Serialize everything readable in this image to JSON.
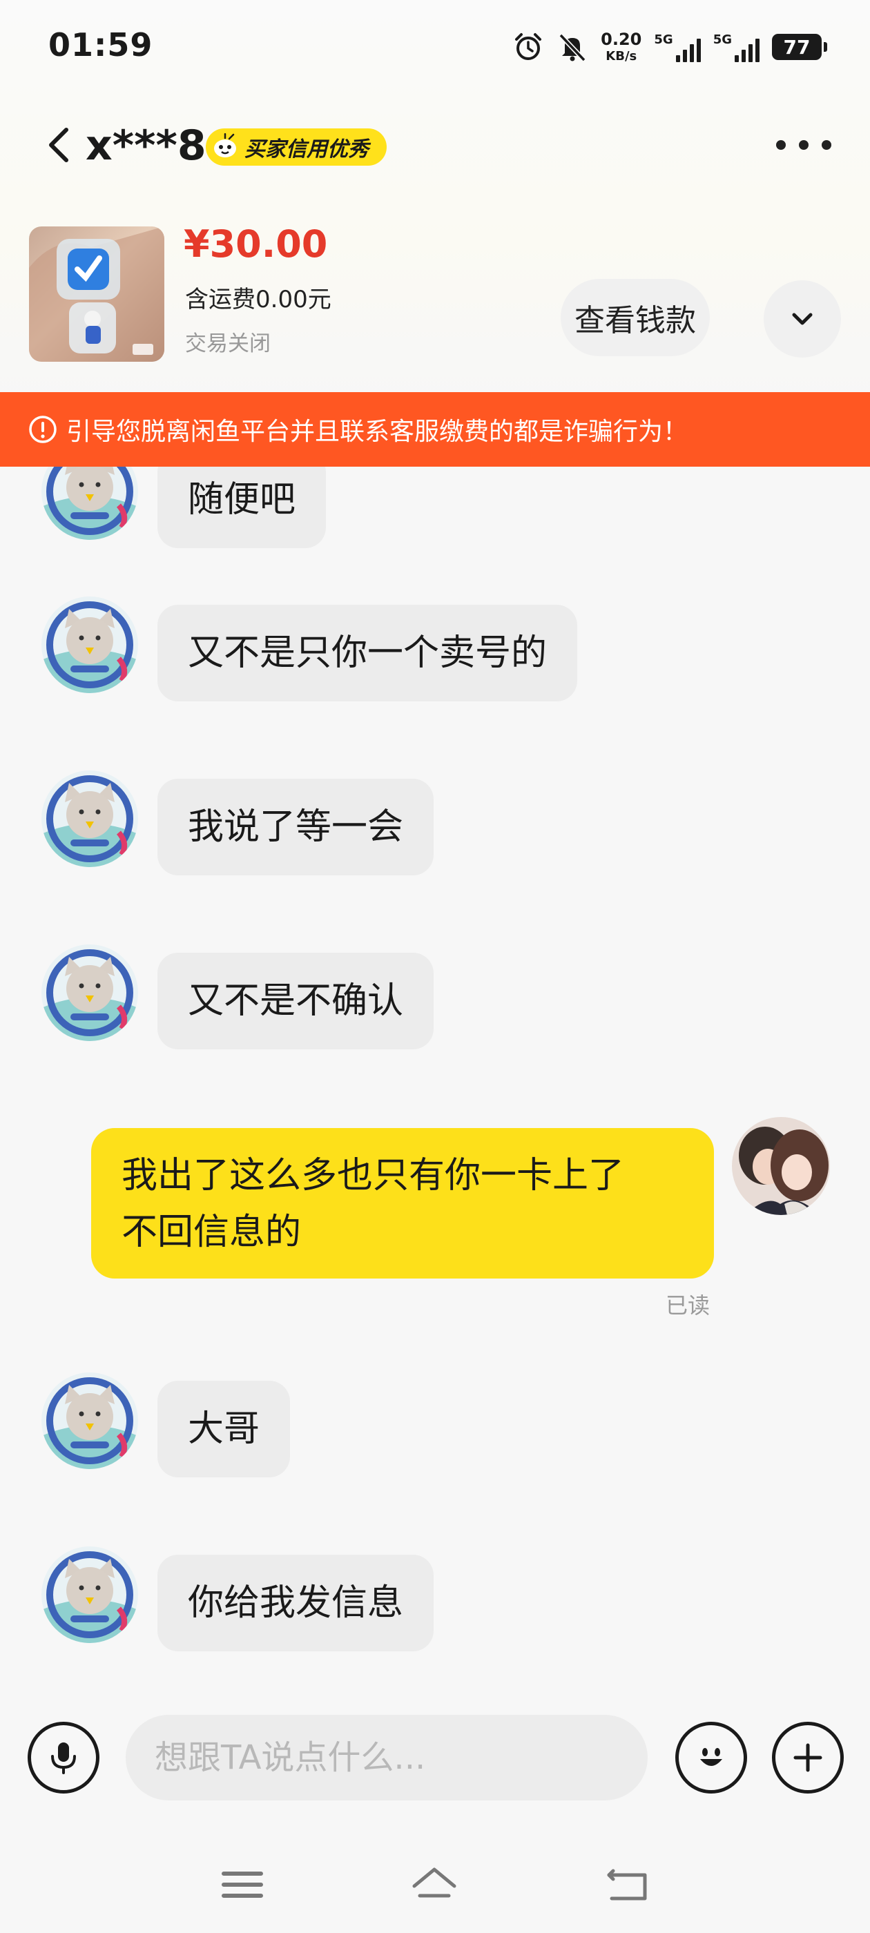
{
  "status_bar": {
    "time": "01:59",
    "net_speed_value": "0.20",
    "net_speed_unit": "KB/s",
    "sim1_label": "5G",
    "sim2_label": "5G",
    "battery": "77"
  },
  "header": {
    "nickname": "x***8",
    "badge": "买家信用优秀",
    "badge_color": "#ffe11b"
  },
  "product": {
    "price": "¥30.00",
    "postage": "含运费0.00元",
    "trade_status": "交易关闭",
    "view_button": "查看钱款",
    "price_color": "#e53a2a"
  },
  "warning": {
    "text": "引导您脱离闲鱼平台并且联系客服缴费的都是诈骗行为！",
    "color": "#ff5722"
  },
  "messages": [
    {
      "sender": "other",
      "text": "随便吧"
    },
    {
      "sender": "other",
      "text": "又不是只你一个卖号的"
    },
    {
      "sender": "other",
      "text": "我说了等一会"
    },
    {
      "sender": "other",
      "text": "又不是不确认"
    },
    {
      "sender": "me",
      "line1": "我出了这么多也只有你一卡上了",
      "line2": "不回信息的",
      "status": "已读"
    },
    {
      "sender": "other",
      "text": "大哥"
    },
    {
      "sender": "other",
      "text": "你给我发信息"
    }
  ],
  "input_bar": {
    "placeholder": "想跟TA说点什么...",
    "voice_icon": "microphone-icon",
    "emoji_icon": "emoji-icon",
    "plus_icon": "plus-icon"
  },
  "bubble_colors": {
    "other": "#ececec",
    "me": "#fde01a"
  }
}
